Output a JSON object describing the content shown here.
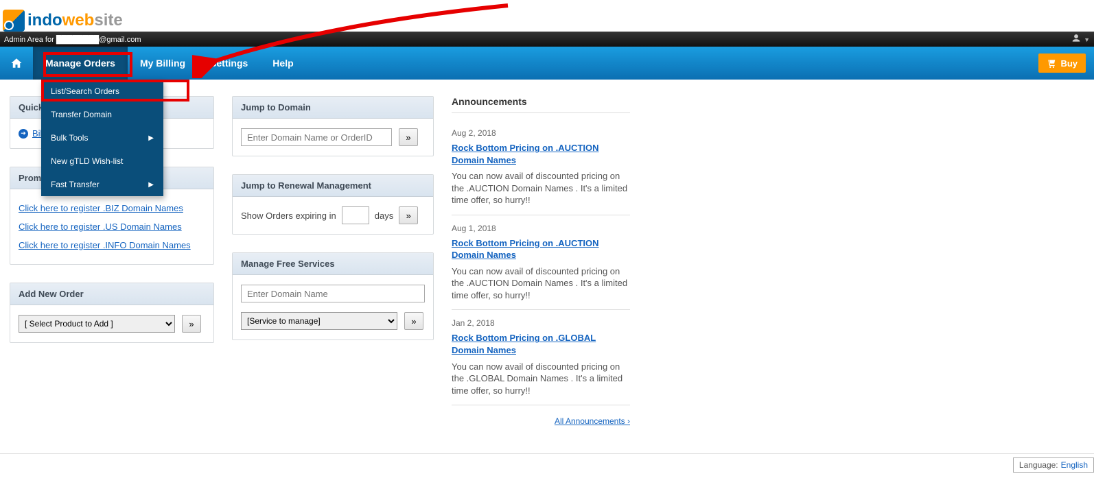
{
  "logo": {
    "part1": "indo",
    "part2": "web",
    "part3": "site"
  },
  "admin_bar": {
    "prefix": "Admin Area for ",
    "email_suffix": "@gmail.com"
  },
  "nav": {
    "items": [
      "Manage Orders",
      "My Billing",
      "Settings",
      "Help"
    ],
    "buy": "Buy"
  },
  "dropdown": {
    "items": [
      {
        "label": "List/Search Orders",
        "arrow": false
      },
      {
        "label": "Transfer Domain",
        "arrow": false
      },
      {
        "label": "Bulk Tools",
        "arrow": true
      },
      {
        "label": "New gTLD Wish-list",
        "arrow": false
      },
      {
        "label": "Fast Transfer",
        "arrow": true
      }
    ]
  },
  "left": {
    "quicklinks": {
      "title": "Quick Links",
      "billing": "Billing"
    },
    "promos": {
      "title": "Promos / Offers",
      "links": [
        "Click here to register .BIZ Domain Names",
        "Click here to register .US Domain Names",
        "Click here to register .INFO Domain Names"
      ]
    },
    "addorder": {
      "title": "Add New Order",
      "select": "[ Select Product to Add ]",
      "go": "»"
    }
  },
  "mid": {
    "jump_domain": {
      "title": "Jump to Domain",
      "placeholder": "Enter Domain Name or OrderID",
      "go": "»"
    },
    "renewal": {
      "title": "Jump to Renewal Management",
      "prefix": "Show Orders expiring in",
      "suffix": "days",
      "go": "»"
    },
    "free": {
      "title": "Manage Free Services",
      "placeholder": "Enter Domain Name",
      "select": "[Service to manage]",
      "go": "»"
    }
  },
  "right": {
    "title": "Announcements",
    "items": [
      {
        "date": "Aug 2, 2018",
        "title": "Rock Bottom Pricing on .AUCTION Domain Names",
        "body": "You can now avail of discounted pricing on the .AUCTION Domain Names . It's a limited time offer, so hurry!!"
      },
      {
        "date": "Aug 1, 2018",
        "title": "Rock Bottom Pricing on .AUCTION Domain Names",
        "body": "You can now avail of discounted pricing on the .AUCTION Domain Names . It's a limited time offer, so hurry!!"
      },
      {
        "date": "Jan 2, 2018",
        "title": "Rock Bottom Pricing on .GLOBAL Domain Names",
        "body": "You can now avail of discounted pricing on the .GLOBAL Domain Names . It's a limited time offer, so hurry!!"
      }
    ],
    "all": "All Announcements ›"
  },
  "footer": {
    "lang_label": "Language:",
    "lang_value": "English"
  }
}
